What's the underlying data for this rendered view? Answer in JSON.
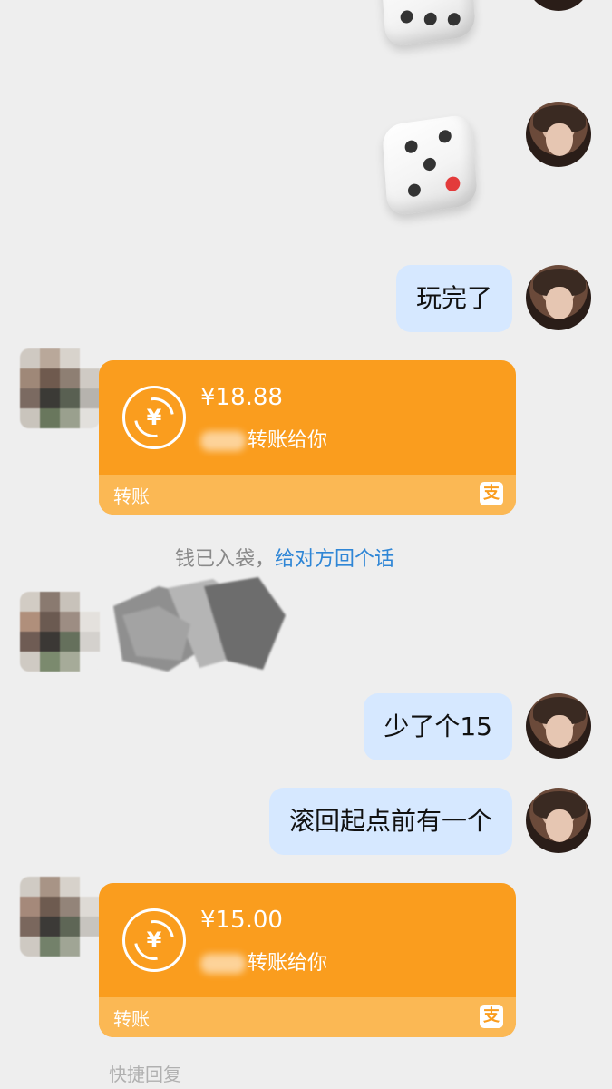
{
  "messages": {
    "msg_text_1": "玩完了",
    "msg_text_2": "少了个15",
    "msg_text_3": "滚回起点前有一个"
  },
  "transfers": [
    {
      "amount": "¥18.88",
      "description": "转账给你",
      "type_label": "转账",
      "app_icon_glyph": "支"
    },
    {
      "amount": "¥15.00",
      "description": "转账给你",
      "type_label": "转账",
      "app_icon_glyph": "支"
    }
  ],
  "coin_glyph": "¥",
  "system_note": {
    "text": "钱已入袋，",
    "link": "给对方回个话"
  },
  "footer": {
    "quick_reply": "快捷回复"
  },
  "colors": {
    "background": "#eeeeee",
    "my_bubble": "#d6e8ff",
    "transfer_card": "#fa9d1e",
    "transfer_card_footer": "#fbb854",
    "link": "#2f86d6"
  },
  "icons": [
    "dice-icon",
    "transfer-coin-icon",
    "alipay-icon",
    "avatar"
  ]
}
